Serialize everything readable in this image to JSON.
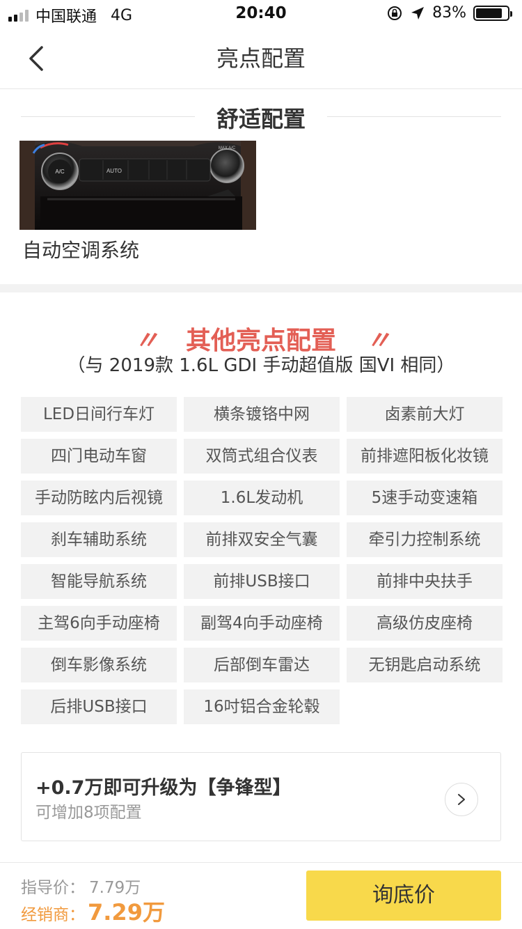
{
  "status_bar": {
    "carrier": "中国联通",
    "network": "4G",
    "time": "20:40",
    "battery": "83%",
    "battery_level": 0.83
  },
  "nav": {
    "title": "亮点配置",
    "back_icon": "chevron-left-icon"
  },
  "comfort": {
    "title": "舒适配置",
    "photo_labels": [
      "A/C",
      "AUTO",
      "MAX A/C"
    ],
    "caption": "自动空调系统"
  },
  "highlights": {
    "title": "其他亮点配置",
    "quote_left": "〃",
    "quote_right": "〃",
    "subtitle": "（与 2019款 1.6L GDI 手动超值版 国VI 相同）",
    "items": [
      "LED日间行车灯",
      "横条镀铬中网",
      "卤素前大灯",
      "四门电动车窗",
      "双筒式组合仪表",
      "前排遮阳板化妆镜",
      "手动防眩内后视镜",
      "1.6L发动机",
      "5速手动变速箱",
      "刹车辅助系统",
      "前排双安全气囊",
      "牵引力控制系统",
      "智能导航系统",
      "前排USB接口",
      "前排中央扶手",
      "主驾6向手动座椅",
      "副驾4向手动座椅",
      "高级仿皮座椅",
      "倒车影像系统",
      "后部倒车雷达",
      "无钥匙启动系统",
      "后排USB接口",
      "16吋铝合金轮毂"
    ]
  },
  "upgrade": {
    "title": "+0.7万即可升级为【争锋型】",
    "subtitle": "可增加8项配置",
    "icon": "chevron-right-icon"
  },
  "bottom_bar": {
    "guide_label": "指导价：",
    "guide_value": "7.79万",
    "dealer_label": "经销商：",
    "dealer_value": "7.29万",
    "ask_button": "询底价"
  },
  "colors": {
    "accent_red": "#e35f55",
    "price_orange": "#f19a3e",
    "button_yellow": "#f8d94b"
  }
}
